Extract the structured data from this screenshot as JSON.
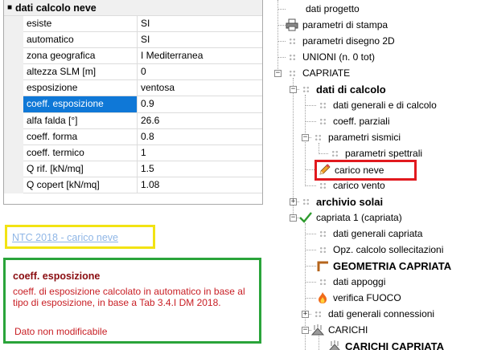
{
  "property_grid": {
    "category": "dati calcolo neve",
    "rows": [
      {
        "name": "esiste",
        "value": "SI"
      },
      {
        "name": "automatico",
        "value": "SI"
      },
      {
        "name": "zona geografica",
        "value": "I Mediterranea"
      },
      {
        "name": "altezza SLM [m]",
        "value": "0"
      },
      {
        "name": "esposizione",
        "value": "ventosa"
      },
      {
        "name": "coeff. esposizione",
        "value": "0.9"
      },
      {
        "name": "alfa falda [°]",
        "value": "26.6"
      },
      {
        "name": "coeff. forma",
        "value": "0.8"
      },
      {
        "name": "coeff. termico",
        "value": "1"
      },
      {
        "name": "Q rif. [kN/mq]",
        "value": "1.5"
      },
      {
        "name": "Q copert [kN/mq]",
        "value": "1.08"
      }
    ],
    "selected_row": "coeff. esposizione"
  },
  "link": {
    "text": "NTC 2018 - carico neve"
  },
  "help": {
    "title": "coeff. esposizione",
    "description": "coeff. di esposizione calcolato in automatico in base al tipo di esposizione, in base a Tab 3.4.I DM 2018.",
    "note": "Dato non modificabile"
  },
  "tree": {
    "items": [
      {
        "label": "dati progetto",
        "icon": "none"
      },
      {
        "label": "parametri di stampa",
        "icon": "printer-icon"
      },
      {
        "label": "parametri disegno 2D",
        "icon": "grid-dots-icon"
      },
      {
        "label": "UNIONI (n. 0 tot)",
        "icon": "grid-dots-icon"
      },
      {
        "label": "CAPRIATE",
        "icon": "grid-dots-icon"
      },
      {
        "label": "dati di calcolo",
        "icon": "grid-dots-icon"
      },
      {
        "label": "dati generali e di calcolo",
        "icon": "grid-dots-icon"
      },
      {
        "label": "coeff. parziali",
        "icon": "grid-dots-icon"
      },
      {
        "label": "parametri sismici",
        "icon": "grid-dots-icon"
      },
      {
        "label": "parametri spettrali",
        "icon": "grid-dots-icon"
      },
      {
        "label": "carico neve",
        "icon": "pencil-icon"
      },
      {
        "label": "carico vento",
        "icon": "grid-dots-icon"
      },
      {
        "label": "archivio solai",
        "icon": "grid-dots-icon"
      },
      {
        "label": "capriata 1 (capriata)",
        "icon": "checkmark-icon"
      },
      {
        "label": "dati generali capriata",
        "icon": "grid-dots-icon"
      },
      {
        "label": "Opz. calcolo sollecitazioni",
        "icon": "grid-dots-icon"
      },
      {
        "label": "GEOMETRIA CAPRIATA",
        "icon": "geometry-icon"
      },
      {
        "label": "dati appoggi",
        "icon": "grid-dots-icon"
      },
      {
        "label": "verifica FUOCO",
        "icon": "fire-icon"
      },
      {
        "label": "dati generali connessioni",
        "icon": "grid-dots-icon"
      },
      {
        "label": "CARICHI",
        "icon": "loads-icon"
      },
      {
        "label": "CARICHI CAPRIATA",
        "icon": "loads-icon"
      }
    ]
  },
  "colors": {
    "selection": "#0f78d7",
    "link_box": "#f2e313",
    "help_box": "#2aa43a",
    "tree_highlight": "#e1191e",
    "help_title": "#8a0c10",
    "help_text": "#c81e24"
  }
}
